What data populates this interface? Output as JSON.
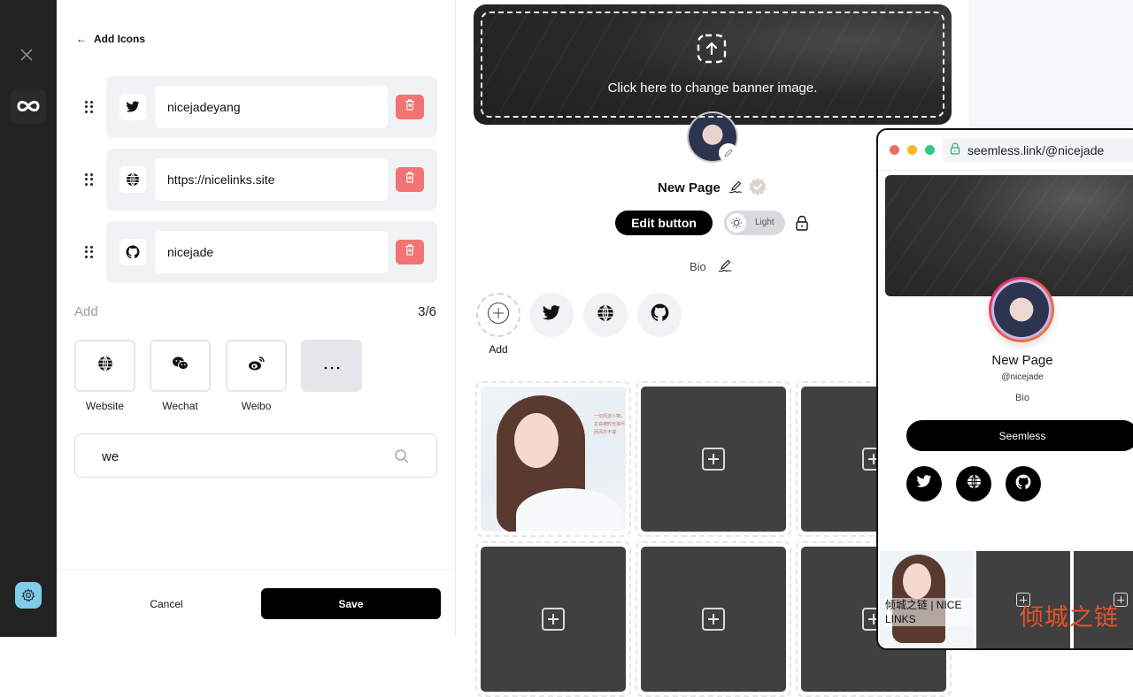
{
  "rail": {
    "close_icon": "close-icon",
    "logo_icon": "infinity-link-icon",
    "settings_icon": "gear-icon",
    "settings_color": "#7fcdea"
  },
  "panel": {
    "back_icon": "arrow-left-icon",
    "title": "Add Icons",
    "links": [
      {
        "icon": "twitter-icon",
        "value": "nicejadeyang"
      },
      {
        "icon": "globe-icon",
        "value": "https://nicelinks.site"
      },
      {
        "icon": "github-icon",
        "value": "nicejade"
      }
    ],
    "delete_color": "#f27373",
    "add_label": "Add",
    "count": "3/6",
    "options": [
      {
        "icon": "globe-icon",
        "label": "Website"
      },
      {
        "icon": "wechat-icon",
        "label": "Wechat"
      },
      {
        "icon": "weibo-icon",
        "label": "Weibo"
      },
      {
        "icon": "more-dots-icon",
        "label": ""
      }
    ],
    "search": {
      "value": "we",
      "placeholder": ""
    },
    "cancel_label": "Cancel",
    "save_label": "Save"
  },
  "editor": {
    "banner_text": "Click here to change banner image.",
    "page_name": "New Page",
    "edit_button_label": "Edit button",
    "theme_label": "Light",
    "bio": "Bio",
    "add_social_label": "Add",
    "socials": [
      "twitter-icon",
      "globe-icon",
      "github-icon"
    ],
    "grid": [
      {
        "type": "image",
        "text": "一切风流人物，总会被时光淘尽而风华不减"
      },
      {
        "type": "empty"
      },
      {
        "type": "empty"
      },
      {
        "type": "empty"
      },
      {
        "type": "empty"
      },
      {
        "type": "empty"
      }
    ]
  },
  "preview": {
    "url": "seemless.link/@nicejade",
    "traffic_lights": [
      "#f26a6a",
      "#f5b82e",
      "#2fcb89"
    ],
    "name": "New Page",
    "handle": "@nicejade",
    "bio": "Bio",
    "button_label": "Seemless",
    "socials": [
      "twitter-icon",
      "globe-icon",
      "github-icon"
    ],
    "tile_caption": "倾城之链 | NICE LINKS"
  },
  "watermark": "倾城之链"
}
